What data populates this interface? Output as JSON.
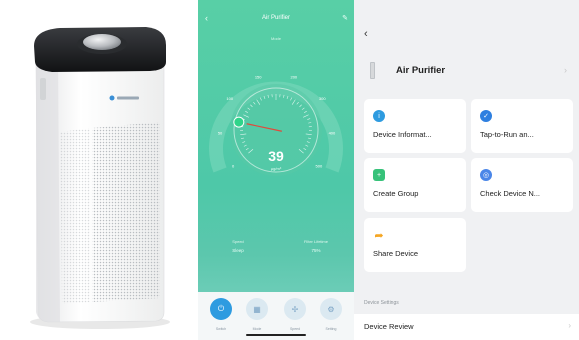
{
  "app_screen": {
    "title": "Air Purifier",
    "mode_label": "Mode",
    "back_icon": "chevron-left-icon",
    "edit_icon": "pencil-icon",
    "dial": {
      "value": "39",
      "unit": "μg/m³",
      "scale_labels": [
        "0",
        "50",
        "100",
        "150",
        "200",
        "300",
        "400",
        "500"
      ],
      "needle_fraction": 0.2
    },
    "stats": [
      {
        "label": "Speed",
        "value": "Sleep"
      },
      {
        "label": "Filter Lifetime",
        "value": "75%"
      }
    ],
    "tabs": [
      {
        "label": "Switch",
        "icon": "power-icon",
        "active": true
      },
      {
        "label": "Mode",
        "icon": "grid-icon",
        "active": false
      },
      {
        "label": "Speed",
        "icon": "fan-icon",
        "active": false
      },
      {
        "label": "Setting",
        "icon": "gear-icon",
        "active": false
      }
    ]
  },
  "settings_screen": {
    "back_icon": "chevron-left-icon",
    "device_name": "Air Purifier",
    "device_icon": "air-purifier-icon",
    "cards": [
      {
        "label": "Device Informat...",
        "icon": "info-icon",
        "color": "#2e9be0"
      },
      {
        "label": "Tap-to-Run an...",
        "icon": "check-badge-icon",
        "color": "#2e7fe0"
      },
      {
        "label": "Create Group",
        "icon": "group-add-icon",
        "color": "#37c27a"
      },
      {
        "label": "Check Device N...",
        "icon": "network-check-icon",
        "color": "#4a86e8"
      },
      {
        "label": "Share Device",
        "icon": "share-arrow-icon",
        "color": "#f5a623"
      }
    ],
    "section_title": "Device Settings",
    "rows": [
      {
        "label": "Device Review"
      }
    ]
  },
  "colors": {
    "app_green": "#4ec8a8",
    "accent_blue": "#2e9be0",
    "settings_bg": "#f0f1f3"
  }
}
